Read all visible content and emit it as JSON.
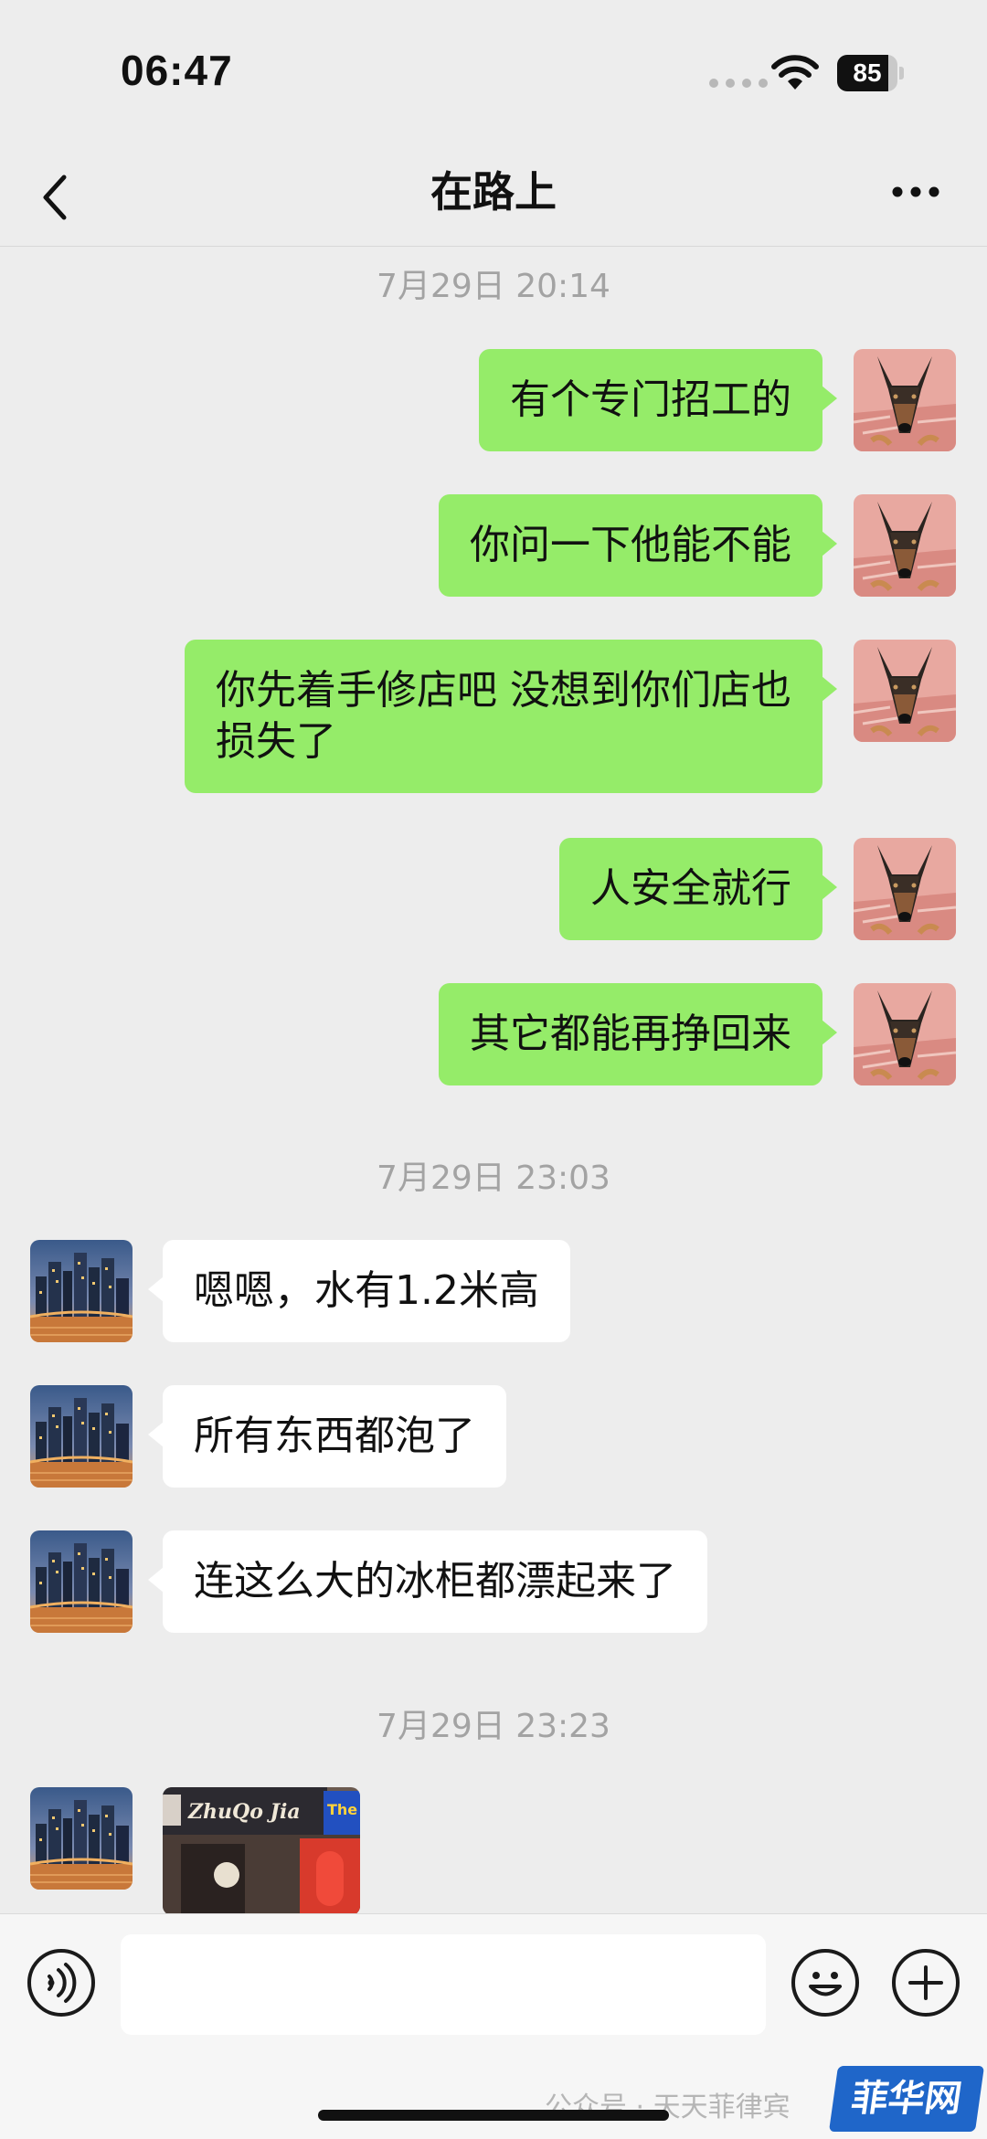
{
  "status_bar": {
    "time": "06:47",
    "battery": "85",
    "battery_level": 0.85
  },
  "nav": {
    "title": "在路上"
  },
  "chat": {
    "timestamps": [
      "7月29日 20:14",
      "7月29日 23:03",
      "7月29日 23:23"
    ],
    "messages": [
      {
        "side": "right",
        "text": "有个专门招工的"
      },
      {
        "side": "right",
        "text": "你问一下他能不能"
      },
      {
        "side": "right",
        "text": "你先着手修店吧 没想到你们店也\n损失了"
      },
      {
        "side": "right",
        "text": "人安全就行"
      },
      {
        "side": "right",
        "text": "其它都能再挣回来"
      },
      {
        "side": "left",
        "text": "嗯嗯，水有1.2米高"
      },
      {
        "side": "left",
        "text": "所有东西都泡了"
      },
      {
        "side": "left",
        "text": "连这么大的冰柜都漂起来了"
      }
    ],
    "photo": {
      "sign_text": "ZhuQo Jia",
      "side_sign": "The"
    }
  },
  "input_bar": {
    "placeholder": ""
  },
  "watermark": "公众号 · 天天菲律宾",
  "site_logo": "菲华网",
  "colors": {
    "outgoing": "#95ec69",
    "incoming": "#ffffff",
    "background": "#ededed"
  }
}
